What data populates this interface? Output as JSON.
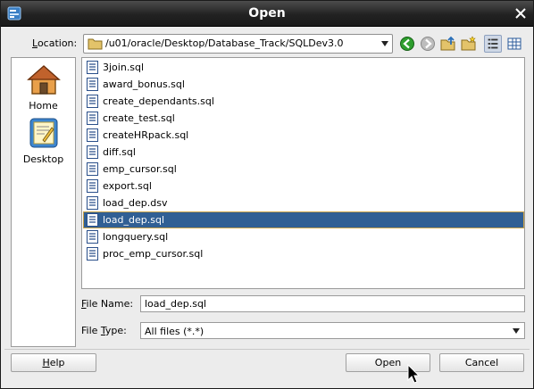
{
  "window": {
    "title": "Open"
  },
  "location": {
    "label_mnemonic": "L",
    "label_rest": "ocation:",
    "path": "/u01/oracle/Desktop/Database_Track/SQLDev3.0"
  },
  "toolbar": [
    "back-icon",
    "forward-icon",
    "up-folder-icon",
    "new-folder-icon",
    "list-view-icon",
    "details-view-icon"
  ],
  "places": [
    {
      "label": "Home",
      "icon": "home-icon"
    },
    {
      "label": "Desktop",
      "icon": "desktop-icon"
    }
  ],
  "files": [
    "3join.sql",
    "award_bonus.sql",
    "create_dependants.sql",
    "create_test.sql",
    "createHRpack.sql",
    "diff.sql",
    "emp_cursor.sql",
    "export.sql",
    "load_dep.dsv",
    "load_dep.sql",
    "longquery.sql",
    "proc_emp_cursor.sql"
  ],
  "selected_file": "load_dep.sql",
  "file_name": {
    "label_mnemonic": "F",
    "label_rest": "ile Name:",
    "value": "load_dep.sql"
  },
  "file_type": {
    "label_prefix": "File ",
    "label_mnemonic": "T",
    "label_rest": "ype:",
    "value": "All files (*.*)"
  },
  "buttons": {
    "help_mnemonic": "H",
    "help_rest": "elp",
    "open": "Open",
    "cancel": "Cancel"
  },
  "colors": {
    "selection": "#305f94",
    "selection_border": "#c7a24a",
    "titlebar": "#222222",
    "nav_green": "#2e9e2e"
  }
}
